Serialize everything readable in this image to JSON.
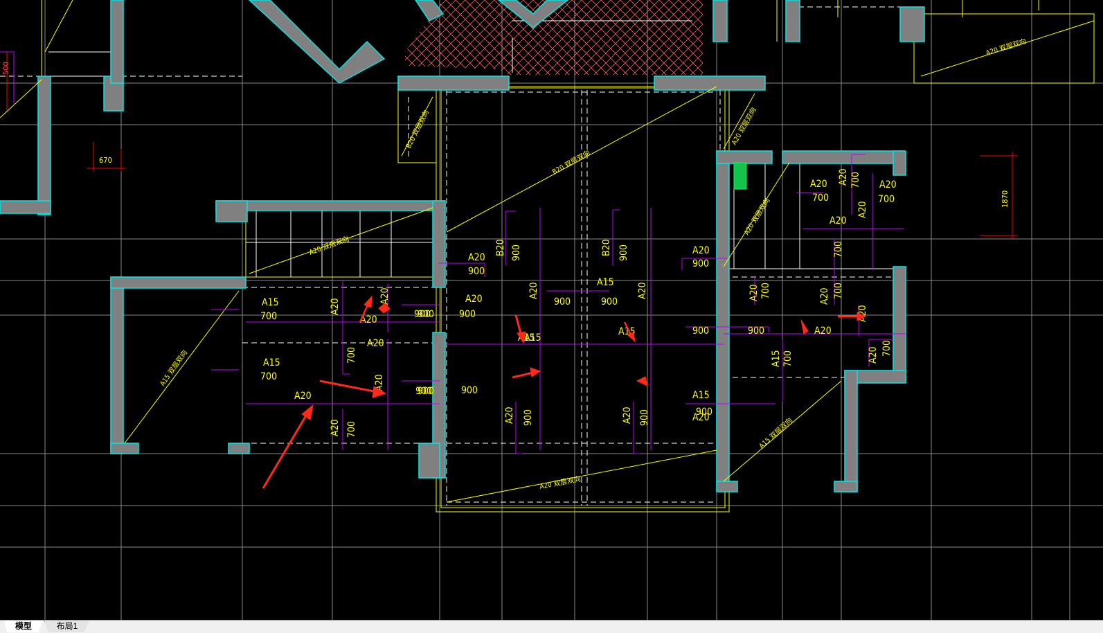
{
  "drawing": {
    "dimensions": {
      "d500": "500",
      "d670": "670",
      "d1870": "1870"
    },
    "zone_labels": {
      "b20_top": "B20 双层双向",
      "a20_stair": "A20 双层双向",
      "a15_left": "A15 双层双向",
      "a20_bottom": "A20 双层双向",
      "a20_right": "A20 双层双向",
      "a15_right": "A15 双层双向",
      "a20_topright": "A20 双层双向",
      "b20_small": "B20 双层双向",
      "a20_small_right": "A20 双层双向"
    },
    "rebar_labels": {
      "l01": "A15",
      "l02": "700",
      "l03": "A15",
      "l04": "700",
      "l05": "A20",
      "l06": "A20",
      "l07": "A20",
      "l08": "700",
      "l09": "A20",
      "l10": "900",
      "l11": "A20",
      "l12": "700",
      "l13": "A20",
      "l14": "900",
      "l15": "A20",
      "l16": "900",
      "l17": "B20",
      "l18": "900",
      "l19": "900",
      "l20": "B20",
      "l21": "900",
      "l22": "A20",
      "l23": "900",
      "l24": "A15",
      "l25": "900",
      "l26": "900",
      "l27": "A20",
      "l28": "A15",
      "l29": "A20",
      "l30": "900",
      "l31": "A15",
      "l32": "900",
      "l33": "900",
      "l34": "A20",
      "l35": "900",
      "l36": "A20",
      "l37": "900",
      "l38": "A15",
      "l39": "900",
      "l40": "A20",
      "l41": "700",
      "l42": "A20",
      "l43": "700",
      "l44": "A20",
      "l45": "700",
      "l46": "A20",
      "l47": "A20",
      "l48": "700",
      "l49": "A20",
      "l50": "700",
      "l51": "A20",
      "l52": "700",
      "l53": "A20",
      "l54": "A15",
      "l55": "700",
      "l56": "A20",
      "l57": "700",
      "l58": "A20",
      "l59": "A20",
      "l60": "A15",
      "l61": "900",
      "l62": "900",
      "l63": "A20",
      "l64": "A20"
    }
  },
  "tabs": {
    "model": "模型",
    "layout1": "布局1"
  },
  "colors": {
    "background": "#000000",
    "wall_fill": "#808080",
    "wall_edge": "#00e5e5",
    "grid": "#8a8a8a",
    "outline_yellow": "#ffff00",
    "rebar_magenta": "#c000ff",
    "dimension_red": "#ff0000",
    "hatch": "#ff5a5a",
    "arrow": "#ff2a1a"
  }
}
